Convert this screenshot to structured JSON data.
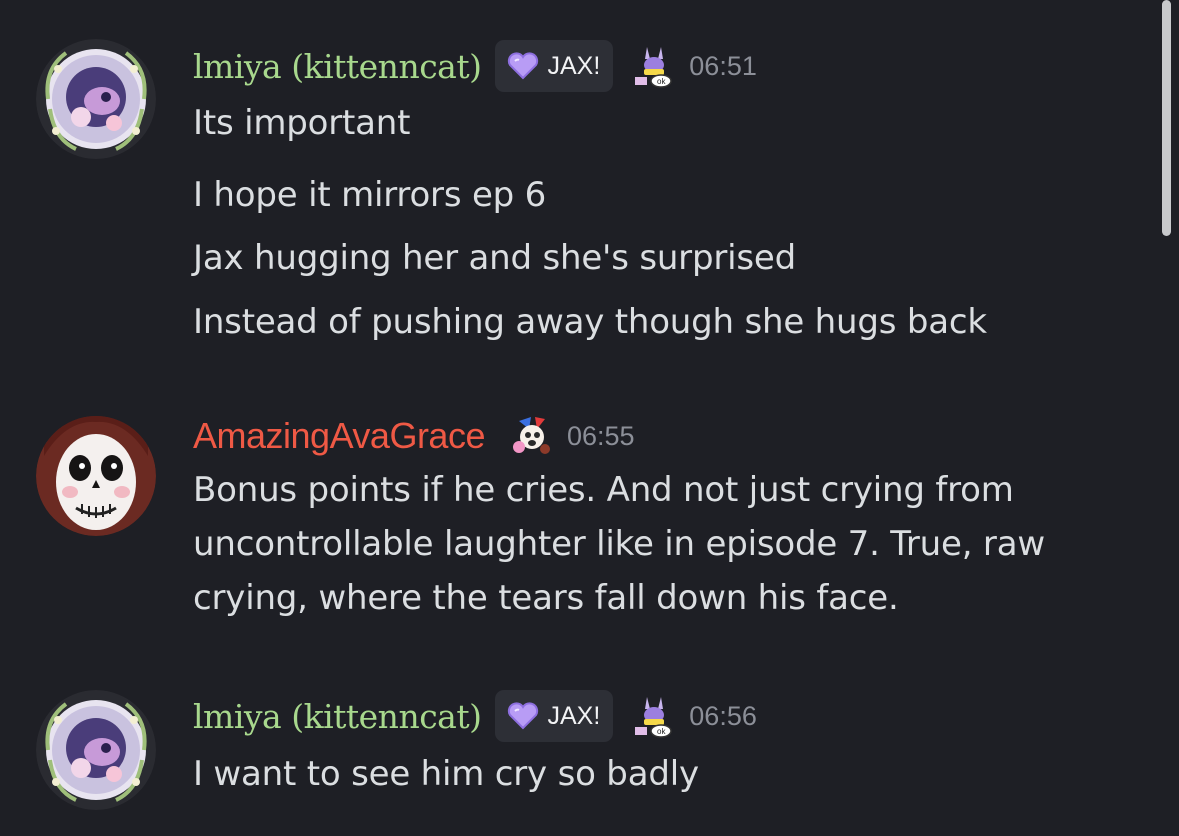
{
  "colors": {
    "background": "#1e1f25",
    "green_username": "#a8d88d",
    "red_username": "#ef5945",
    "timestamp": "#8c8f98",
    "tag_bg": "#2d2f36",
    "tag_heart": "#b89cf5"
  },
  "messages": [
    {
      "username": "lmiya (kittenncat)",
      "tag": {
        "icon": "purple-heart-icon",
        "label": "JAX!"
      },
      "badge_icon": "jax-bunny-emoji-icon",
      "timestamp": "06:51",
      "lines": [
        "Its important",
        "I hope it mirrors ep 6",
        "Jax hugging her and she's surprised",
        "Instead of pushing away though she hugs back"
      ]
    },
    {
      "username": "AmazingAvaGrace",
      "badge_icon": "pomni-jester-emoji-icon",
      "timestamp": "06:55",
      "lines": [
        "Bonus points if he cries. And not just crying from",
        "uncontrollable laughter like in episode 7. True, raw",
        "crying, where the tears fall down his face."
      ]
    },
    {
      "username": "lmiya (kittenncat)",
      "tag": {
        "icon": "purple-heart-icon",
        "label": "JAX!"
      },
      "badge_icon": "jax-bunny-emoji-icon",
      "timestamp": "06:56",
      "lines": [
        "I want to see him cry so badly"
      ]
    }
  ]
}
